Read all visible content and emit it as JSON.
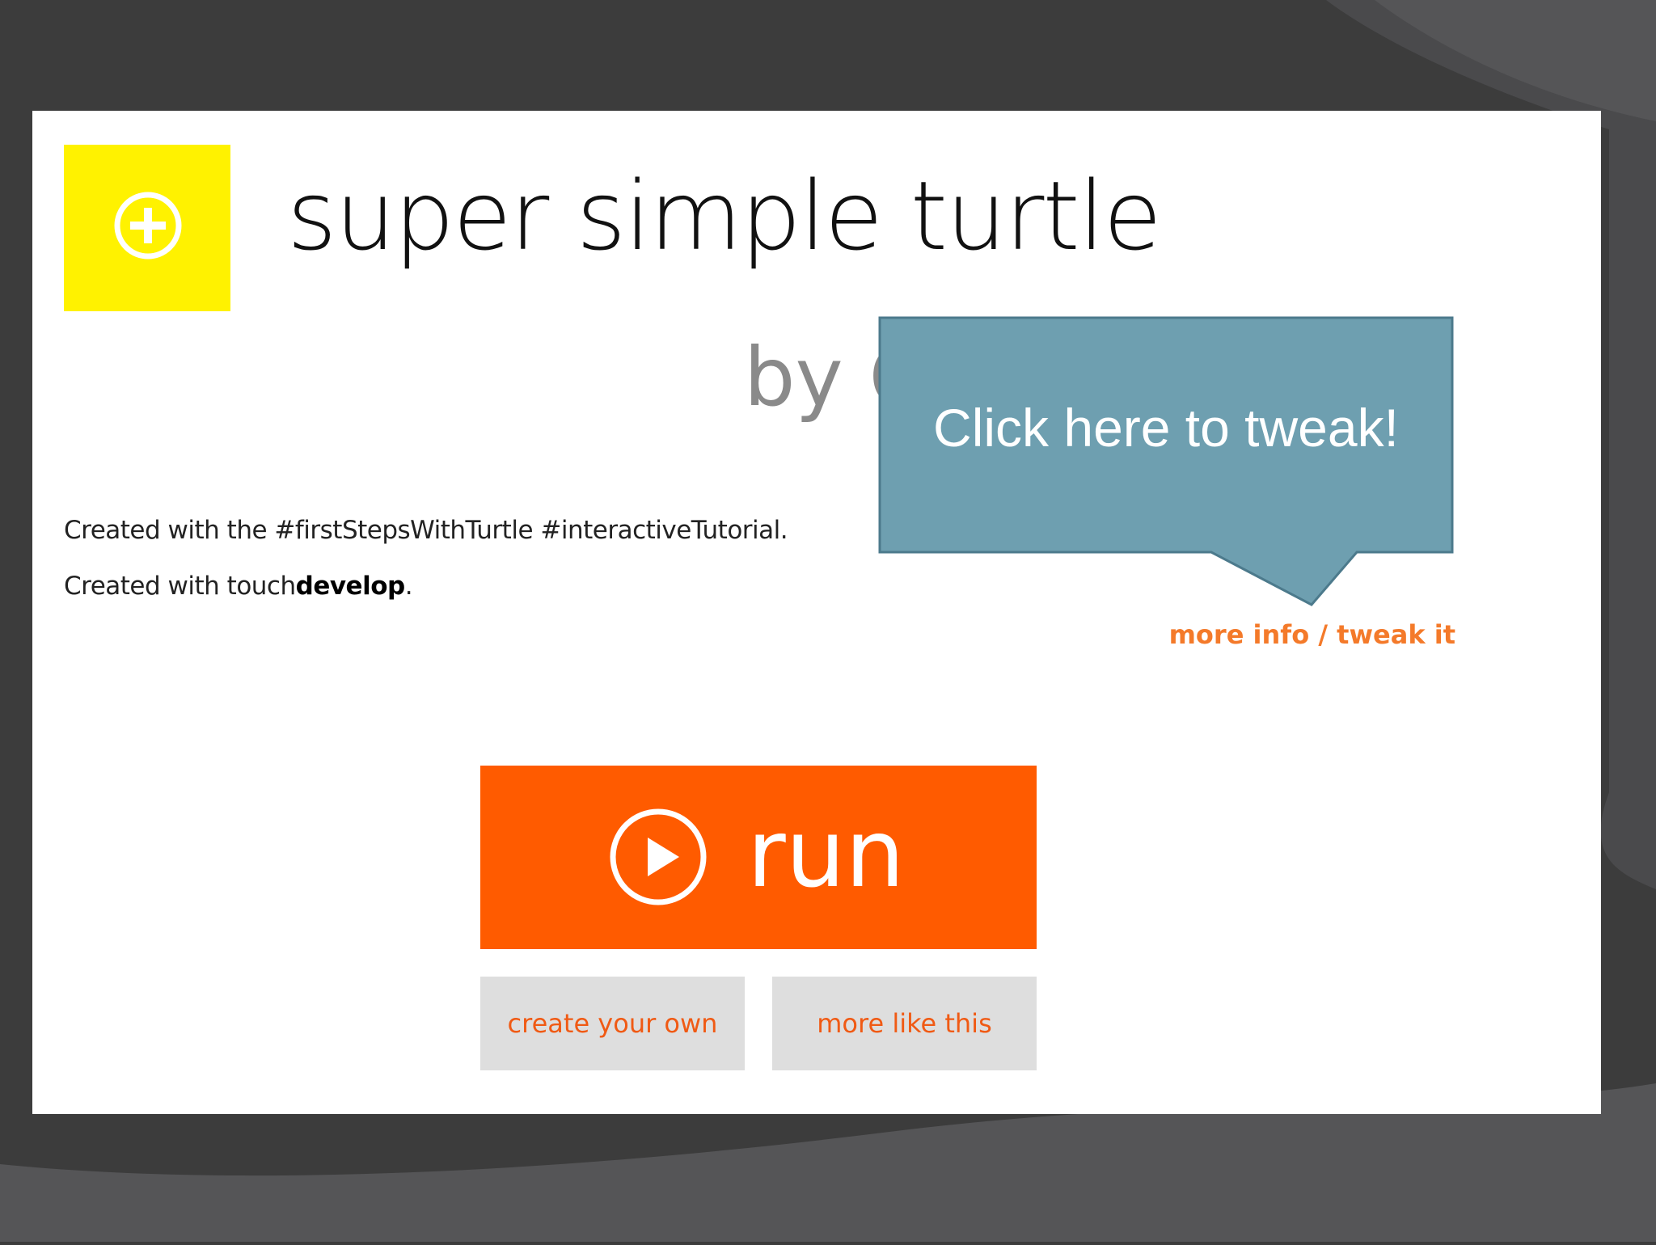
{
  "app": {
    "title": "super simple turtle",
    "author_line": "by C",
    "description_line1": "Created with the #firstStepsWithTurtle #interactiveTutorial.",
    "description_line2_prefix": "Created with touch",
    "description_line2_bold": "develop",
    "description_line2_suffix": ".",
    "more_info_link": "more info / tweak it"
  },
  "callout": {
    "text": "Click here to tweak!"
  },
  "buttons": {
    "run_label": "run",
    "create_label": "create your own",
    "more_like_label": "more like this"
  },
  "icons": {
    "app_icon": "plus-circle-icon",
    "run_icon": "play-circle-icon"
  },
  "colors": {
    "tile": "#fff200",
    "run": "#ff5b00",
    "link": "#f47a2a",
    "callout": "#6e9fb0",
    "secondary_bg": "#dedede"
  }
}
